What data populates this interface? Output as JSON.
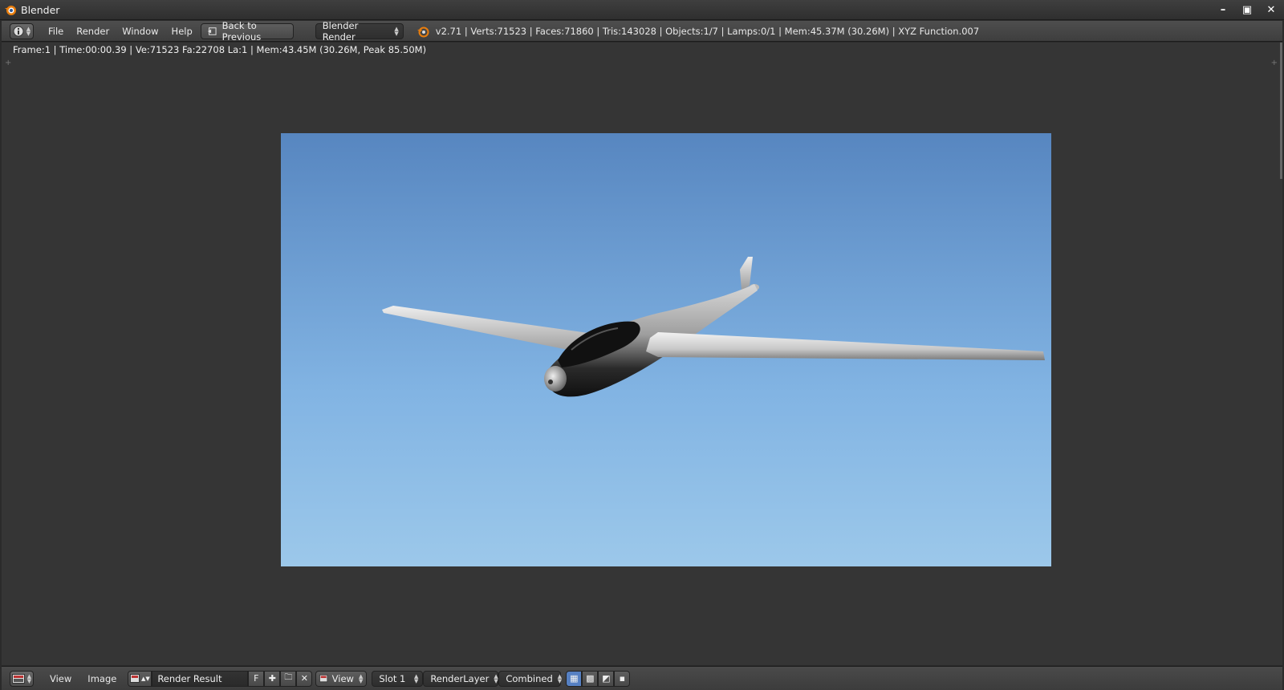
{
  "window": {
    "title": "Blender"
  },
  "info_header": {
    "menus": [
      "File",
      "Render",
      "Window",
      "Help"
    ],
    "back_button": "Back to Previous",
    "render_engine": "Blender Render",
    "stats": "v2.71 | Verts:71523 | Faces:71860 | Tris:143028 | Objects:1/7 | Lamps:0/1 | Mem:45.37M (30.26M) | XYZ Function.007"
  },
  "image_editor": {
    "render_info": "Frame:1 | Time:00:00.39 | Ve:71523 Fa:22708 La:1 | Mem:43.45M (30.26M, Peak 85.50M)"
  },
  "image_header": {
    "menus": [
      "View",
      "Image"
    ],
    "image_name": "Render Result",
    "fake_user": "F",
    "view_mode": "View",
    "slot": "Slot 1",
    "render_layer": "RenderLayer",
    "pass": "Combined"
  },
  "colors": {
    "sky_top": "#5786c0",
    "sky_bottom": "#9cc8ea",
    "accent": "#e87d0d",
    "panel_bg": "#353535"
  },
  "icons": [
    "blender-logo-icon",
    "info-editor-icon",
    "back-icon",
    "image-editor-icon",
    "image-browse-icon",
    "new-image-icon",
    "open-image-icon",
    "unlink-icon",
    "draw-alpha-icon",
    "checker-icon",
    "z-buffer-icon",
    "pin-icon"
  ]
}
